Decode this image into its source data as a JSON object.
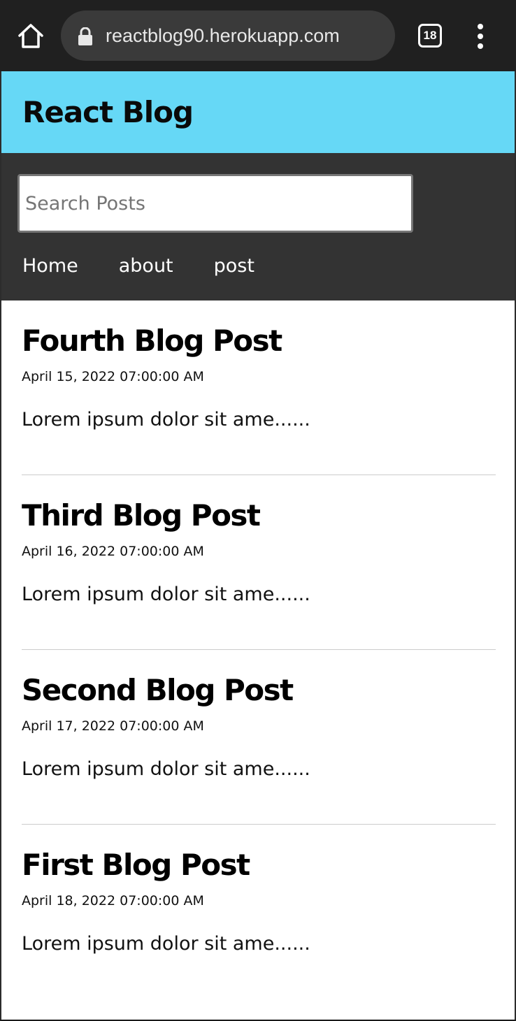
{
  "browser": {
    "url": "reactblog90.herokuapp.com",
    "tab_count": "18"
  },
  "site": {
    "title": "React Blog"
  },
  "search": {
    "placeholder": "Search Posts",
    "value": ""
  },
  "nav": {
    "items": [
      {
        "label": "Home"
      },
      {
        "label": "about"
      },
      {
        "label": "post"
      }
    ]
  },
  "posts": [
    {
      "title": "Fourth Blog Post",
      "date": "April 15, 2022 07:00:00 AM",
      "excerpt": "Lorem ipsum dolor sit ame......"
    },
    {
      "title": "Third Blog Post",
      "date": "April 16, 2022 07:00:00 AM",
      "excerpt": "Lorem ipsum dolor sit ame......"
    },
    {
      "title": "Second Blog Post",
      "date": "April 17, 2022 07:00:00 AM",
      "excerpt": "Lorem ipsum dolor sit ame......"
    },
    {
      "title": "First Blog Post",
      "date": "April 18, 2022 07:00:00 AM",
      "excerpt": "Lorem ipsum dolor sit ame......"
    }
  ],
  "icons": {
    "home": "home-icon",
    "lock": "lock-icon",
    "menu": "more-vertical-icon"
  },
  "colors": {
    "header_bg": "#66d8f6",
    "nav_bg": "#333333",
    "browser_bg": "#202020"
  }
}
